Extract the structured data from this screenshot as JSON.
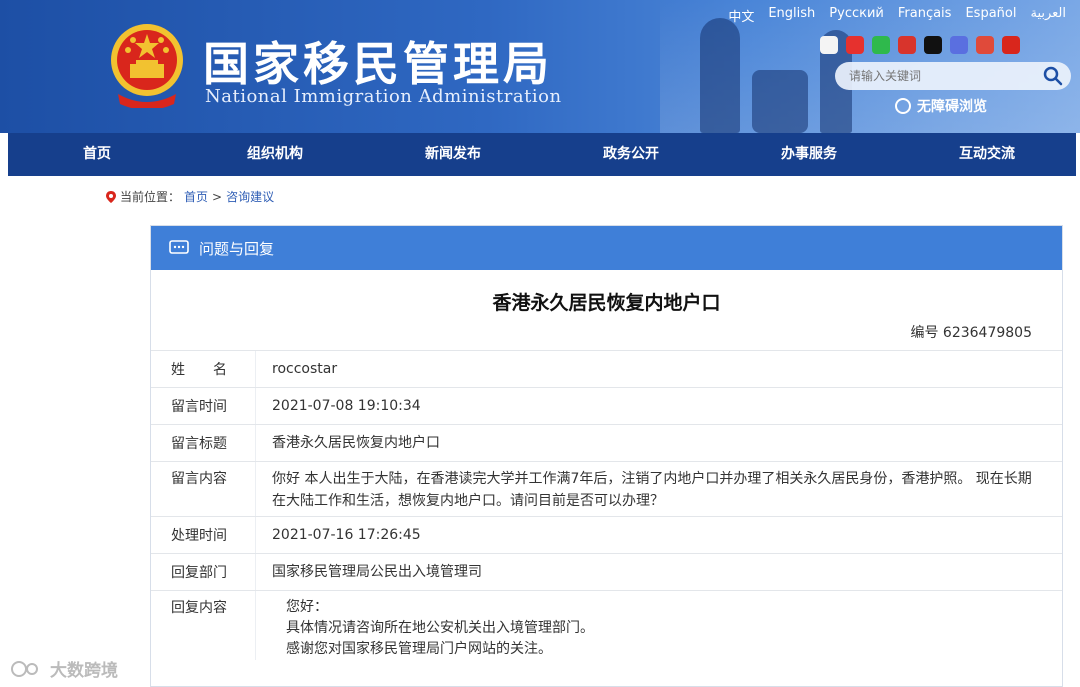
{
  "header": {
    "title": "国家移民管理局",
    "subtitle": "National Immigration Administration",
    "languages": [
      "中文",
      "English",
      "Русский",
      "Français",
      "Español",
      "العربية"
    ],
    "search_placeholder": "请输入关键词",
    "accessibility_label": "无障碍浏览"
  },
  "nav": {
    "items": [
      "首页",
      "组织机构",
      "新闻发布",
      "政务公开",
      "办事服务",
      "互动交流"
    ]
  },
  "breadcrumb": {
    "prefix": "当前位置：",
    "home": "首页",
    "separator": ">",
    "current": "咨询建议"
  },
  "panel": {
    "header_label": "问题与回复",
    "title": "香港永久居民恢复内地户口",
    "number_label": "编号",
    "number_value": "6236479805",
    "rows": [
      {
        "label": "姓　　名",
        "value": "roccostar"
      },
      {
        "label": "留言时间",
        "value": "2021-07-08 19:10:34"
      },
      {
        "label": "留言标题",
        "value": "香港永久居民恢复内地户口"
      },
      {
        "label": "留言内容",
        "value": "你好 本人出生于大陆，在香港读完大学并工作满7年后，注销了内地户口并办理了相关永久居民身份，香港护照。 现在长期在大陆工作和生活，想恢复内地户口。请问目前是否可以办理？"
      },
      {
        "label": "处理时间",
        "value": "2021-07-16 17:26:45"
      },
      {
        "label": "回复部门",
        "value": "国家移民管理局公民出入境管理司"
      }
    ],
    "reply": {
      "label": "回复内容",
      "lines": [
        "您好：",
        "具体情况请咨询所在地公安机关出入境管理部门。",
        "感谢您对国家移民管理局门户网站的关注。"
      ]
    }
  },
  "footer_mark": "大数跨境",
  "colors": {
    "header_blue": "#1d4fa5",
    "nav_blue": "#163f8c",
    "panel_head_blue": "#3f7fd8"
  }
}
